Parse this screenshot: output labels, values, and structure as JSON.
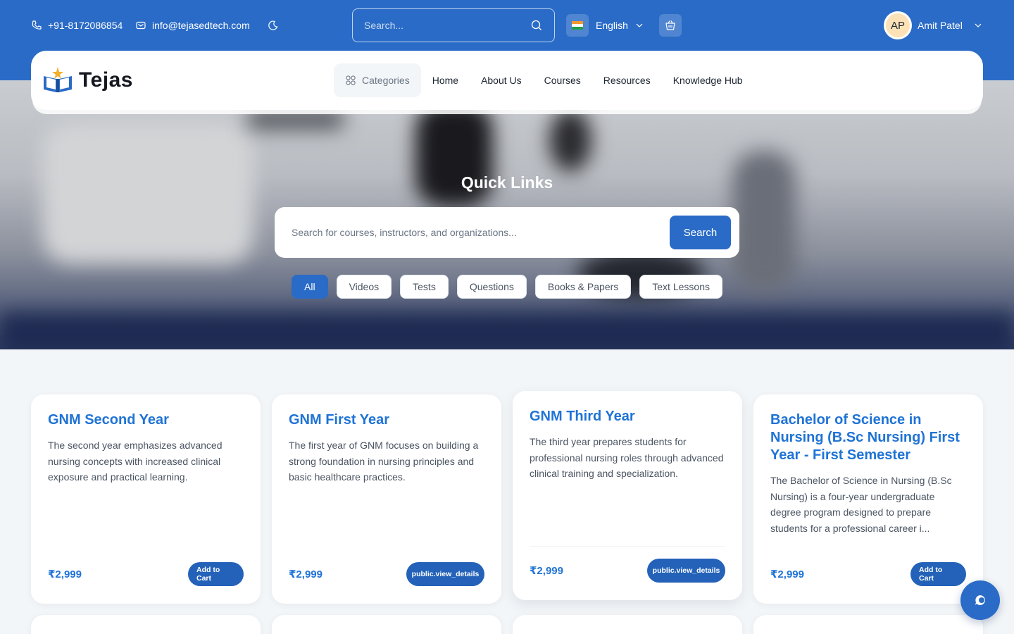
{
  "topbar": {
    "phone": "+91-8172086854",
    "email": "info@tejasedtech.com",
    "search_placeholder": "Search...",
    "language": "English",
    "user_initials": "AP",
    "user_name": "Amit Patel"
  },
  "brand": {
    "name": "Tejas"
  },
  "nav": {
    "categories": "Categories",
    "links": [
      "Home",
      "About Us",
      "Courses",
      "Resources",
      "Knowledge Hub"
    ]
  },
  "hero": {
    "title": "Quick Links",
    "search_placeholder": "Search for courses, instructors, and organizations...",
    "search_button": "Search",
    "filters": [
      "All",
      "Videos",
      "Tests",
      "Questions",
      "Books & Papers",
      "Text Lessons"
    ],
    "active_filter": "All"
  },
  "courses": [
    {
      "title": "GNM Second Year",
      "description": "The second year emphasizes advanced nursing concepts with increased clinical exposure and practical learning.",
      "price": "₹2,999",
      "button": "Add to Cart"
    },
    {
      "title": "GNM First Year",
      "description": "The first year of GNM focuses on building a strong foundation in nursing principles and basic healthcare practices.",
      "price": "₹2,999",
      "button": "public.view_details"
    },
    {
      "title": "GNM Third Year",
      "description": "The third year prepares students for professional nursing roles through advanced clinical training and specialization.",
      "price": "₹2,999",
      "button": "public.view_details"
    },
    {
      "title": "Bachelor of Science in Nursing (B.Sc Nursing) First Year - First Semester",
      "description": "The Bachelor of Science in Nursing (B.Sc Nursing) is a four-year undergraduate degree program designed to prepare students for a professional career i...",
      "price": "₹2,999",
      "button": "Add to Cart"
    }
  ],
  "colors": {
    "primary": "#2a6bc7",
    "title_blue": "#1f73d6",
    "background": "#f3f6f8"
  },
  "icons": {
    "phone": "phone-icon",
    "mail": "mail-icon",
    "theme": "moon-icon",
    "search": "search-icon",
    "cart": "cart-icon",
    "chevron": "chevron-down-icon",
    "categories": "grid-icon",
    "chat": "chat-icon"
  }
}
